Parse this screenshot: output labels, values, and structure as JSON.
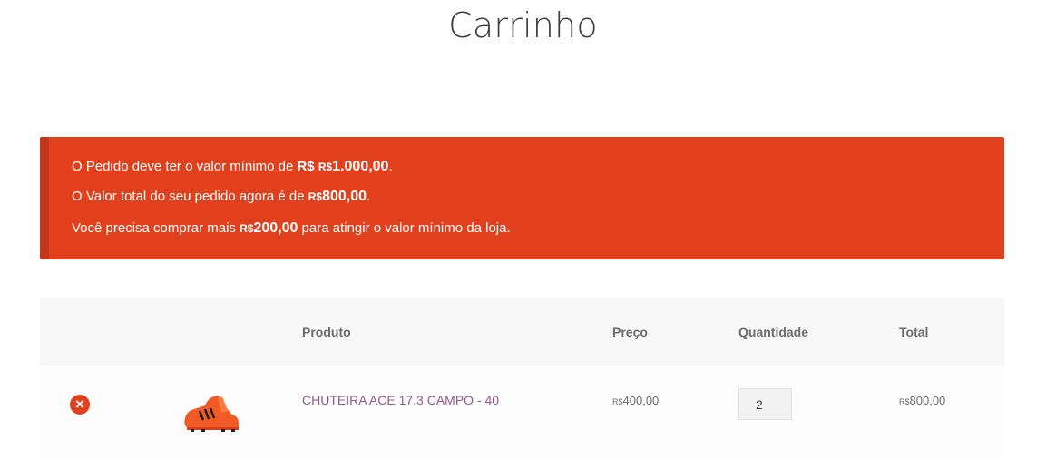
{
  "page": {
    "title": "Carrinho"
  },
  "notice": {
    "line1_text": "O Pedido deve ter o valor mínimo de",
    "line1_currency_main": "R$",
    "line1_currency_small": "R$",
    "line1_amount": "1.000,00",
    "line1_end": ".",
    "line2_text": "O Valor total do seu pedido agora é de",
    "line2_currency": "R$",
    "line2_amount": "800,00",
    "line2_end": ".",
    "line3_text": "Você precisa comprar mais",
    "line3_currency": "R$",
    "line3_amount": "200,00",
    "line3_end": "para atingir o valor mínimo da loja.",
    "color": "#e2401c"
  },
  "cart": {
    "columns": {
      "product": "Produto",
      "price": "Preço",
      "quantity": "Quantidade",
      "total": "Total"
    },
    "items": [
      {
        "remove_icon": "remove-x-circle-icon",
        "thumbnail": "football-boot",
        "name": "CHUTEIRA ACE 17.3 CAMPO - 40",
        "price_currency": "R$",
        "price": "400,00",
        "quantity": "2",
        "total_currency": "R$",
        "total": "800,00"
      }
    ],
    "link_color": "#96588a"
  }
}
